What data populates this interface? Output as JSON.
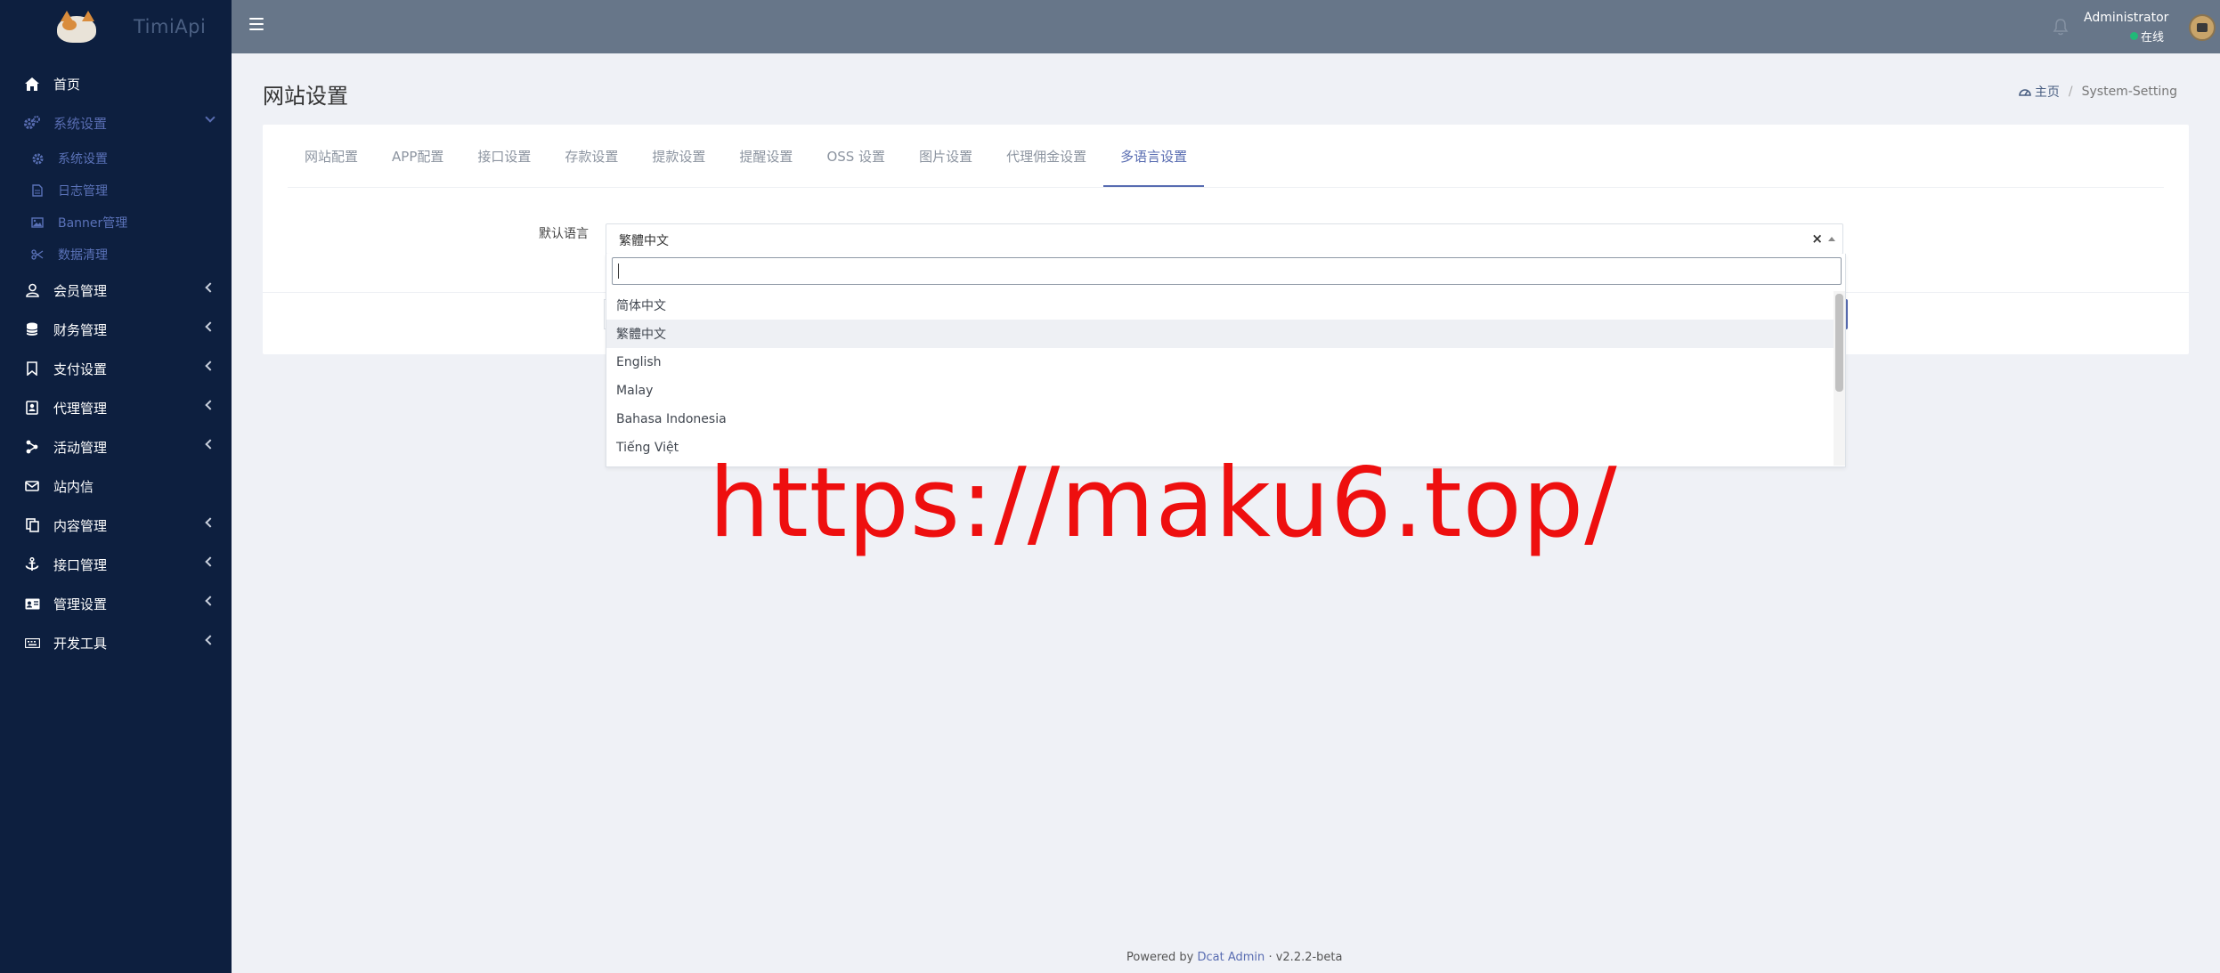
{
  "brand": {
    "title": "TimiApi"
  },
  "topbar": {
    "user_name": "Administrator",
    "user_status": "在线"
  },
  "sidebar": {
    "items": [
      {
        "label": "首页",
        "icon": "home-icon"
      },
      {
        "label": "系统设置",
        "icon": "gears-icon",
        "expanded": true,
        "children": [
          {
            "label": "系统设置",
            "icon": "gear-icon"
          },
          {
            "label": "日志管理",
            "icon": "file-icon"
          },
          {
            "label": "Banner管理",
            "icon": "image-icon"
          },
          {
            "label": "数据清理",
            "icon": "scissors-icon"
          }
        ]
      },
      {
        "label": "会员管理",
        "icon": "user-icon"
      },
      {
        "label": "财务管理",
        "icon": "database-icon"
      },
      {
        "label": "支付设置",
        "icon": "bookmark-icon"
      },
      {
        "label": "代理管理",
        "icon": "contact-icon"
      },
      {
        "label": "活动管理",
        "icon": "share-icon"
      },
      {
        "label": "站内信",
        "icon": "envelope-icon"
      },
      {
        "label": "内容管理",
        "icon": "copy-icon"
      },
      {
        "label": "接口管理",
        "icon": "anchor-icon"
      },
      {
        "label": "管理设置",
        "icon": "id-card-icon"
      },
      {
        "label": "开发工具",
        "icon": "keyboard-icon"
      }
    ]
  },
  "page": {
    "title": "网站设置",
    "breadcrumb": {
      "home": "主页",
      "current": "System-Setting"
    }
  },
  "tabs": [
    {
      "label": "网站配置"
    },
    {
      "label": "APP配置"
    },
    {
      "label": "接口设置"
    },
    {
      "label": "存款设置"
    },
    {
      "label": "提款设置"
    },
    {
      "label": "提醒设置"
    },
    {
      "label": "OSS 设置"
    },
    {
      "label": "图片设置"
    },
    {
      "label": "代理佣金设置"
    },
    {
      "label": "多语言设置",
      "active": true
    }
  ],
  "form": {
    "default_language_label": "默认语言",
    "selected_value": "繁體中文",
    "clear_symbol": "×"
  },
  "dropdown": {
    "search_value": "",
    "options": [
      {
        "label": "简体中文"
      },
      {
        "label": "繁體中文",
        "highlighted": true
      },
      {
        "label": "English"
      },
      {
        "label": "Malay"
      },
      {
        "label": "Bahasa Indonesia"
      },
      {
        "label": "Tiếng Việt"
      }
    ]
  },
  "watermark": {
    "text": "https://maku6.top/"
  },
  "footer": {
    "prefix": "Powered by",
    "link": "Dcat Admin",
    "separator": "·",
    "version": "v2.2.2-beta"
  },
  "colors": {
    "sidebar_bg": "#0d1f3f",
    "topbar_bg": "#677689",
    "accent": "#586cb1",
    "watermark": "#ee0f0f",
    "online": "#21b978"
  }
}
